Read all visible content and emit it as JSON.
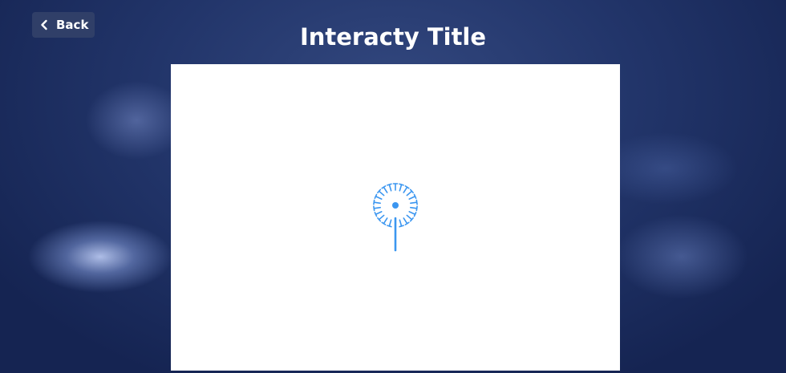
{
  "header": {
    "back_label": "Back",
    "title": "Interacty Title"
  },
  "icons": {
    "back": "chevron-left-icon",
    "loader": "dandelion-loading-icon"
  },
  "colors": {
    "background": "#1a2a55",
    "accent": "#3b96f0",
    "canvas": "#ffffff",
    "button_bg": "#324068"
  }
}
